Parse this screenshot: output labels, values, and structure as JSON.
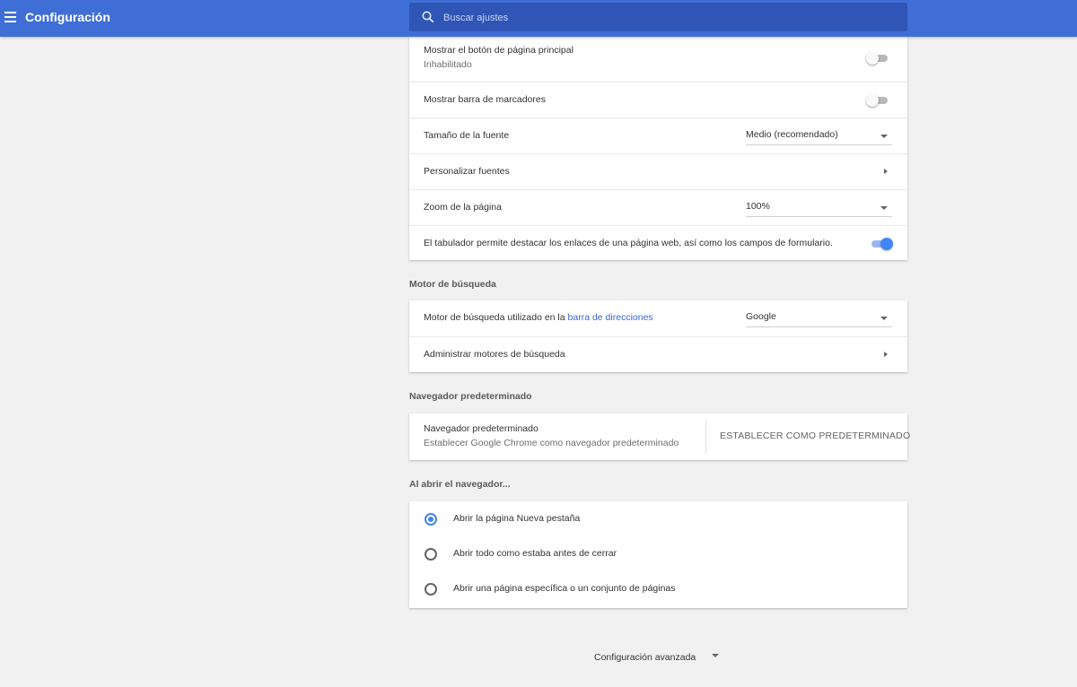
{
  "app": {
    "title": "Configuración",
    "menu_icon": "hamburger-menu-icon",
    "accent_color": "#3f6fd6"
  },
  "search": {
    "placeholder": "Buscar ajustes",
    "value": "",
    "icon": "search-icon"
  },
  "appearance": {
    "home_button": {
      "label": "Mostrar el botón de página principal",
      "sublabel": "Inhabilitado",
      "enabled": false
    },
    "bookmarks_bar": {
      "label": "Mostrar barra de marcadores",
      "enabled": false
    },
    "font_size": {
      "label": "Tamaño de la fuente",
      "value": "Medio (recomendado)"
    },
    "customize_fonts": {
      "label": "Personalizar fuentes"
    },
    "page_zoom": {
      "label": "Zoom de la página",
      "value": "100%"
    },
    "tab_highlight": {
      "label": "El tabulador permite destacar los enlaces de una página web, así como los campos de formulario.",
      "enabled": true
    }
  },
  "search_engine": {
    "title": "Motor de búsqueda",
    "engine_label_prefix": "Motor de búsqueda utilizado en la",
    "engine_label_link": "barra de direcciones",
    "engine_value": "Google",
    "manage_label": "Administrar motores de búsqueda"
  },
  "default_browser": {
    "title": "Navegador predeterminado",
    "label": "Navegador predeterminado",
    "sublabel": "Establecer Google Chrome como navegador predeterminado",
    "button": "ESTABLECER COMO PREDETERMINADO"
  },
  "on_startup": {
    "title": "Al abrir el navegador...",
    "options": [
      {
        "label": "Abrir la página Nueva pestaña",
        "checked": true
      },
      {
        "label": "Abrir todo como estaba antes de cerrar",
        "checked": false
      },
      {
        "label": "Abrir una página específica o un conjunto de páginas",
        "checked": false
      }
    ]
  },
  "advanced": {
    "label": "Configuración avanzada"
  }
}
